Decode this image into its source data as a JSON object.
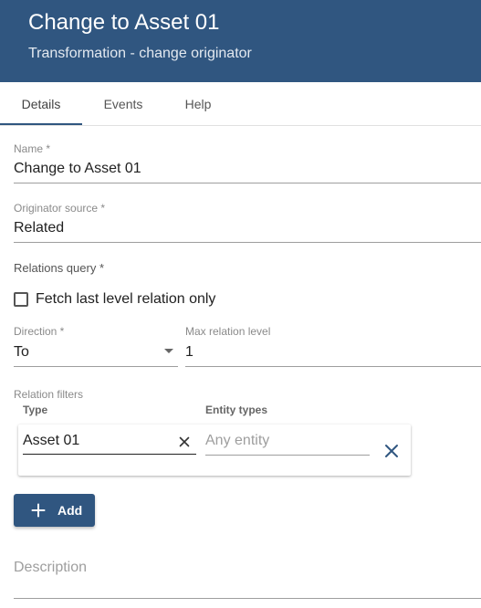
{
  "header": {
    "title": "Change to Asset 01",
    "subtitle": "Transformation - change originator"
  },
  "tabs": [
    {
      "label": "Details",
      "active": true
    },
    {
      "label": "Events",
      "active": false
    },
    {
      "label": "Help",
      "active": false
    }
  ],
  "form": {
    "name": {
      "label": "Name *",
      "value": "Change to Asset 01"
    },
    "originator_source": {
      "label": "Originator source *",
      "value": "Related"
    },
    "relations_query": {
      "label": "Relations query *",
      "fetch_last_level": {
        "label": "Fetch last level relation only",
        "checked": false
      },
      "direction": {
        "label": "Direction *",
        "value": "To"
      },
      "max_relation_level": {
        "label": "Max relation level",
        "value": "1"
      }
    },
    "relation_filters": {
      "label": "Relation filters",
      "type_header": "Type",
      "entity_types_header": "Entity types",
      "rows": [
        {
          "type": "Asset 01",
          "entity_placeholder": "Any entity"
        }
      ],
      "add_label": "Add"
    },
    "description": {
      "placeholder": "Description"
    }
  },
  "icons": {
    "clear": "close-icon",
    "remove": "close-icon",
    "add": "plus-icon",
    "direction_dropdown": "caret-down-icon"
  },
  "colors": {
    "primary": "#305680",
    "remove_icon": "#305680"
  }
}
